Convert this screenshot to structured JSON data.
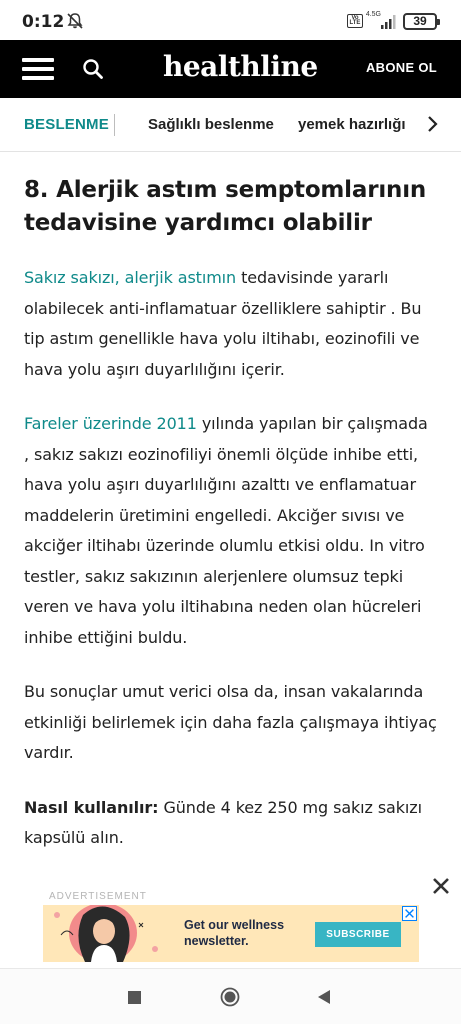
{
  "status_bar": {
    "time": "0:12",
    "network_type": "4.5G",
    "volte": "Vo LTE",
    "battery": "39"
  },
  "header": {
    "logo": "healthline",
    "subscribe": "ABONE OL",
    "icons": [
      "menu-icon",
      "search-icon"
    ]
  },
  "category_nav": {
    "primary": "BESLENME",
    "items": [
      "Sağlıklı beslenme",
      "yemek hazırlığı"
    ]
  },
  "article": {
    "heading": "8. Alerjik astım semptomlarının tedavisine yardımcı olabilir",
    "p1": {
      "link": "Sakız sakızı, alerjik astımın",
      "text": " tedavisinde yararlı olabilecek anti-inflamatuar özelliklere sahiptir . Bu tip astım genellikle hava yolu iltihabı, eozinofili ve hava yolu aşırı duyarlılığını içerir."
    },
    "p2": {
      "link": "Fareler üzerinde 2011",
      "text": " yılında yapılan bir çalışmada , sakız sakızı eozinofiliyi önemli ölçüde inhibe etti, hava yolu aşırı duyarlılığını azalttı ve enflamatuar maddelerin üretimini engelledi. Akciğer sıvısı ve akciğer iltihabı üzerinde olumlu etkisi oldu. In vitro testler, sakız sakızının alerjenlere olumsuz tepki veren ve hava yolu iltihabına neden olan hücreleri inhibe ettiğini buldu."
    },
    "p3": "Bu sonuçlar umut verici olsa da, insan vakalarında etkinliği belirlemek için daha fazla çalışmaya ihtiyaç vardır.",
    "p4": {
      "label": "Nasıl kullanılır:",
      "text": " Günde 4 kez 250 mg sakız sakızı kapsülü alın."
    }
  },
  "ad": {
    "label": "ADVERTISEMENT",
    "text_line1": "Get our wellness",
    "text_line2": "newsletter.",
    "cta": "SUBSCRIBE",
    "colors": {
      "background": "#ffe7b8",
      "cta": "#38b5c4"
    }
  },
  "colors": {
    "accent": "#0f8a8a",
    "header_bg": "#000000"
  }
}
